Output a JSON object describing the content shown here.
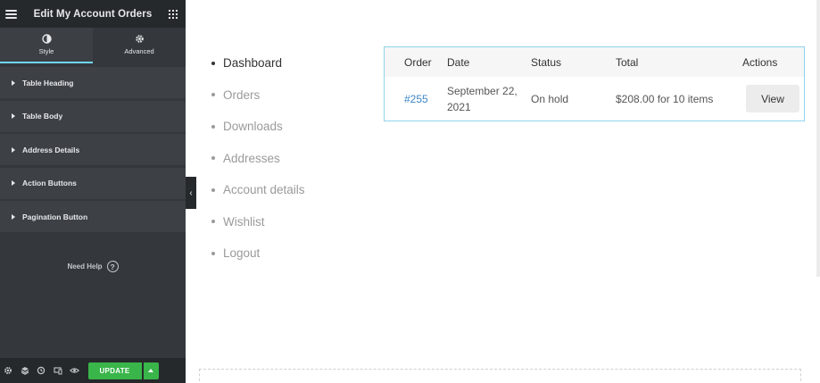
{
  "panel": {
    "title": "Edit My Account Orders",
    "tabs": [
      {
        "label": "Style",
        "icon": "contrast-icon",
        "active": true
      },
      {
        "label": "Advanced",
        "icon": "gear-icon",
        "active": false
      }
    ],
    "sections": [
      {
        "label": "Table Heading"
      },
      {
        "label": "Table Body"
      },
      {
        "label": "Address Details"
      },
      {
        "label": "Action Buttons"
      },
      {
        "label": "Pagination Button"
      }
    ],
    "need_help": "Need Help",
    "help_symbol": "?",
    "update_label": "UPDATE",
    "collapse_symbol": "‹",
    "accent_color": "#71d7f7",
    "update_color": "#39b54a"
  },
  "account_nav": {
    "items": [
      {
        "label": "Dashboard",
        "active": true
      },
      {
        "label": "Orders",
        "active": false
      },
      {
        "label": "Downloads",
        "active": false
      },
      {
        "label": "Addresses",
        "active": false
      },
      {
        "label": "Account details",
        "active": false
      },
      {
        "label": "Wishlist",
        "active": false
      },
      {
        "label": "Logout",
        "active": false
      }
    ]
  },
  "orders_table": {
    "headers": {
      "order": "Order",
      "date": "Date",
      "status": "Status",
      "total": "Total",
      "actions": "Actions"
    },
    "rows": [
      {
        "order": "#255",
        "date": "September 22, 2021",
        "status": "On hold",
        "total": "$208.00 for 10 items",
        "action": "View"
      }
    ],
    "link_color": "#3d85c6",
    "border_color": "#8fd3ea"
  }
}
